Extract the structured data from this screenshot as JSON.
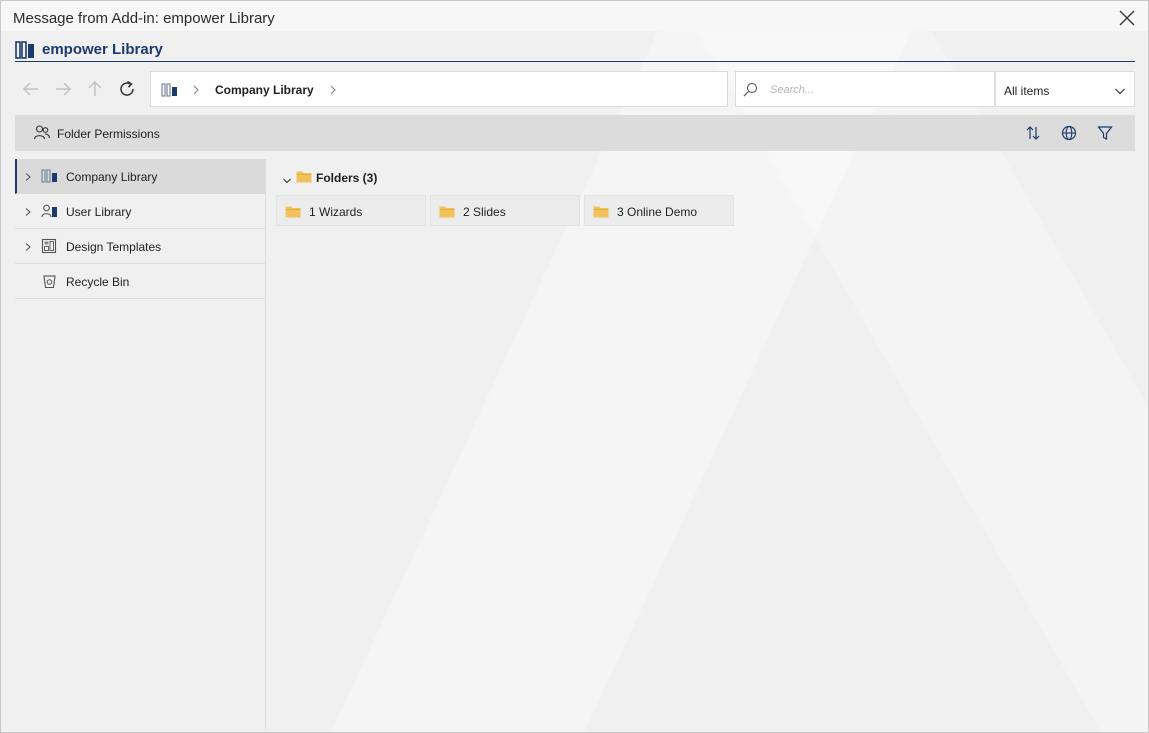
{
  "window": {
    "title": "Message from Add-in: empower Library"
  },
  "brand": {
    "name": "empower Library",
    "color": "#1b3b6f"
  },
  "nav": {
    "breadcrumb": [
      "Company Library"
    ],
    "search_placeholder": "Search...",
    "filter_selected": "All items"
  },
  "toolbar": {
    "folder_permissions_label": "Folder Permissions"
  },
  "sidebar": {
    "items": [
      {
        "label": "Company Library",
        "icon": "company-library-icon",
        "expandable": true,
        "active": true
      },
      {
        "label": "User Library",
        "icon": "user-library-icon",
        "expandable": true,
        "active": false
      },
      {
        "label": "Design Templates",
        "icon": "design-templates-icon",
        "expandable": true,
        "active": false
      },
      {
        "label": "Recycle Bin",
        "icon": "recycle-bin-icon",
        "expandable": false,
        "active": false
      }
    ]
  },
  "content": {
    "group_label": "Folders (3)",
    "folders": [
      {
        "label": "1 Wizards"
      },
      {
        "label": "2 Slides"
      },
      {
        "label": "3 Online Demo"
      }
    ],
    "folder_color": "#f2c25c"
  }
}
